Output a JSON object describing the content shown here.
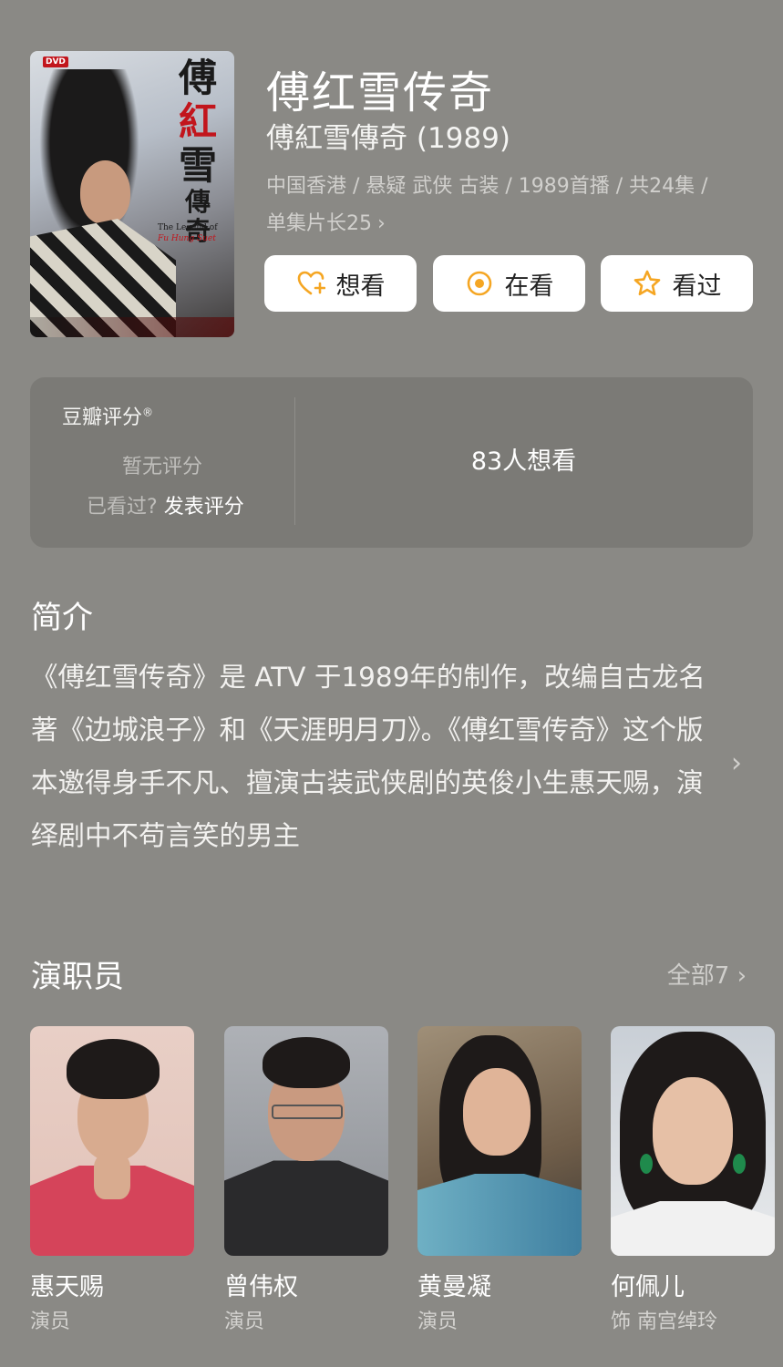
{
  "poster": {
    "dvd_label": "DVD",
    "calligraphy": [
      "傅",
      "紅",
      "雪",
      "傳",
      "奇"
    ],
    "english_title": "The Legend of",
    "english_name": "Fu Hung Suet"
  },
  "header": {
    "title": "傅红雪传奇",
    "subtitle": "傅紅雪傳奇 (1989)",
    "meta": "中国香港 / 悬疑 武侠 古装 / 1989首播 / 共24集 / 单集片长25",
    "meta_chevron": "›"
  },
  "actions": {
    "want_label": "想看",
    "watching_label": "在看",
    "watched_label": "看过",
    "accent_color": "#f5a623"
  },
  "rating": {
    "label": "豆瓣评分",
    "label_mark": "®",
    "no_rating": "暂无评分",
    "seen_prompt": "已看过?",
    "rate_link": "发表评分",
    "want_count": "83人想看"
  },
  "intro": {
    "title": "简介",
    "text": "《傅红雪传奇》是 ATV 于1989年的制作，改编自古龙名著《边城浪子》和《天涯明月刀》。《傅红雪传奇》这个版本邀得身手不凡、擅演古装武侠剧的英俊小生惠天赐，演绎剧中不苟言笑的男主",
    "chevron": "›"
  },
  "cast": {
    "title": "演职员",
    "all_label": "全部7",
    "all_chevron": "›",
    "members": [
      {
        "name": "惠天赐",
        "role": "演员"
      },
      {
        "name": "曾伟权",
        "role": "演员"
      },
      {
        "name": "黄曼凝",
        "role": "演员"
      },
      {
        "name": "何佩儿",
        "role": "饰 南宫绰玲"
      }
    ]
  }
}
